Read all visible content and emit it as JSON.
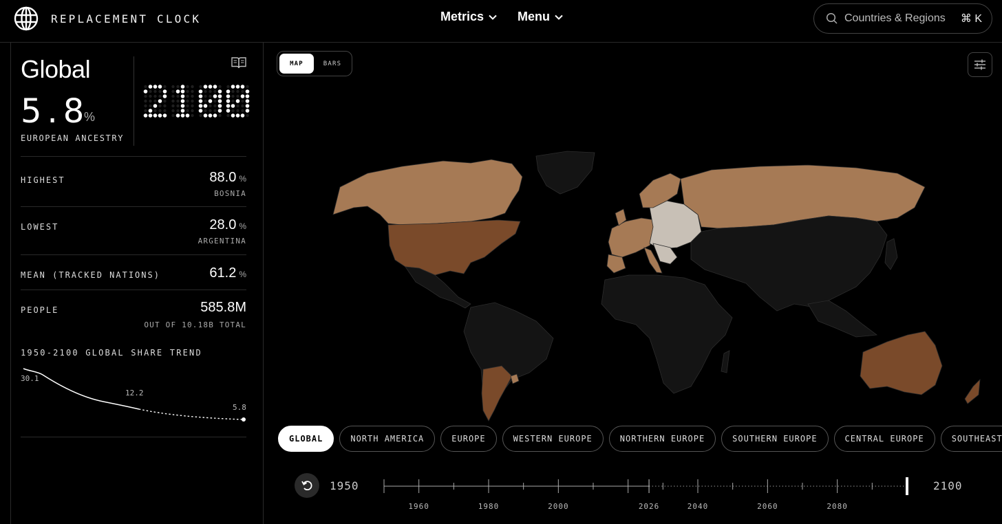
{
  "header": {
    "brand": "REPLACEMENT CLOCK",
    "nav": [
      {
        "label": "Metrics"
      },
      {
        "label": "Menu"
      }
    ],
    "search_placeholder": "Countries & Regions",
    "search_shortcut": "⌘ K"
  },
  "summary": {
    "region": "Global",
    "value": "5.8",
    "unit": "%",
    "label": "EUROPEAN ANCESTRY",
    "year": "2100"
  },
  "stats": {
    "highest": {
      "label": "HIGHEST",
      "value": "88.0",
      "unit": "%",
      "sub": "BOSNIA"
    },
    "lowest": {
      "label": "LOWEST",
      "value": "28.0",
      "unit": "%",
      "sub": "ARGENTINA"
    },
    "mean": {
      "label": "MEAN (TRACKED NATIONS)",
      "value": "61.2",
      "unit": "%"
    },
    "people": {
      "label": "PEOPLE",
      "value": "585.8M",
      "sub": "OUT OF 10.18B TOTAL"
    }
  },
  "trend": {
    "title": "1950-2100 GLOBAL SHARE TREND",
    "start_label": "30.1",
    "mid_label": "12.2",
    "end_label": "5.8"
  },
  "view_toggle": {
    "map": "MAP",
    "bars": "BARS",
    "active": "MAP"
  },
  "regions": [
    "GLOBAL",
    "NORTH AMERICA",
    "EUROPE",
    "WESTERN EUROPE",
    "NORTHERN EUROPE",
    "SOUTHERN EUROPE",
    "CENTRAL EUROPE",
    "SOUTHEAST"
  ],
  "active_region": "GLOBAL",
  "timeline": {
    "start": "1950",
    "end": "2100",
    "ticks": [
      "1960",
      "1980",
      "2000",
      "2026",
      "2040",
      "2060",
      "2080"
    ],
    "selected": "2100"
  },
  "map_colors": {
    "high": "#c8c0b6",
    "mid": "#a67a55",
    "low": "#7a4a2a",
    "none": "#141414",
    "border": "#2c2c2c"
  }
}
